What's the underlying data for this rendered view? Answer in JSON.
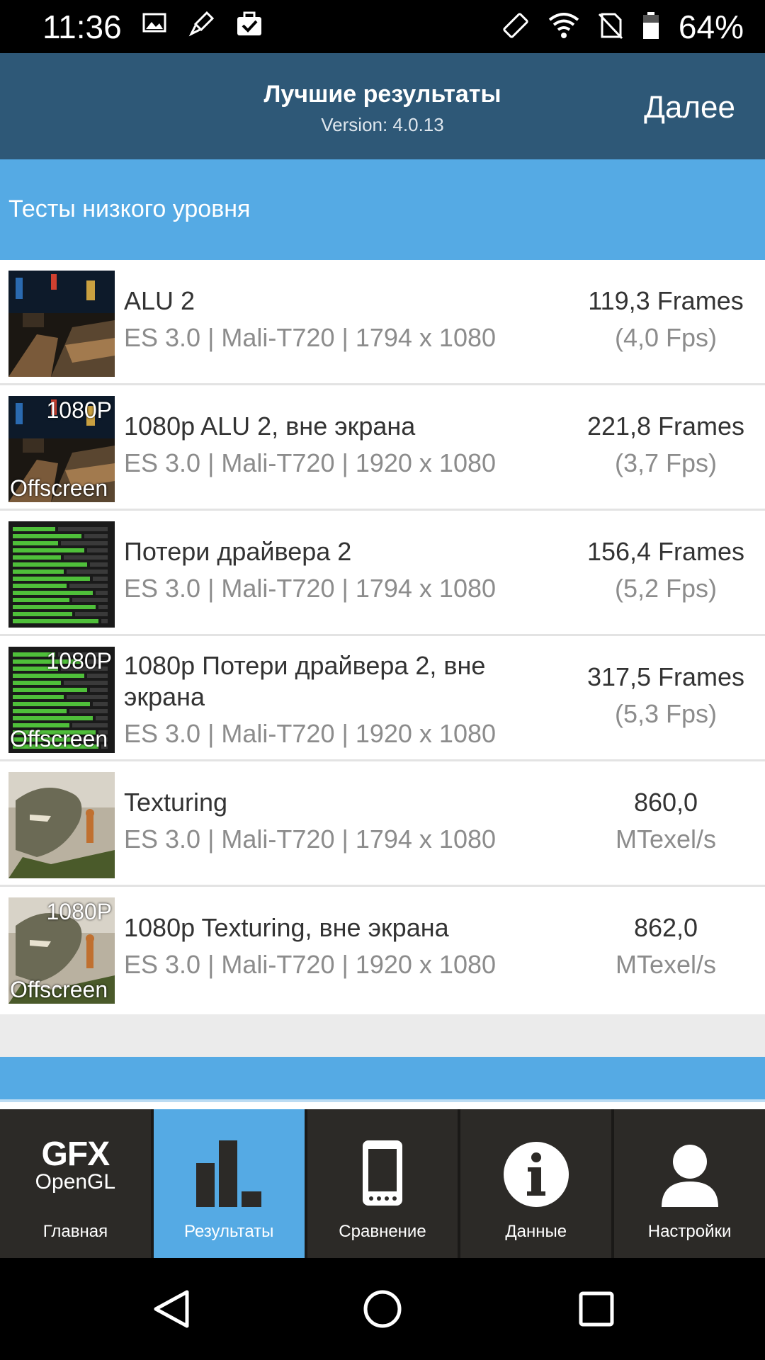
{
  "status_bar": {
    "time": "11:36",
    "battery_percent": "64%",
    "left_icons": [
      "image-icon",
      "brush-icon",
      "briefcase-check-icon"
    ],
    "right_icons": [
      "rotate-icon",
      "wifi-icon",
      "no-sim-icon",
      "battery-icon"
    ]
  },
  "header": {
    "title": "Лучшие результаты",
    "version": "Version: 4.0.13",
    "next_label": "Далее"
  },
  "section": {
    "title": "Тесты низкого уровня"
  },
  "results": [
    {
      "name": "ALU 2",
      "meta": "ES 3.0 | Mali-T720 | 1794 x 1080",
      "value": "119,3 Frames",
      "sub": "(4,0 Fps)",
      "thumb": "alu",
      "badge_top": "",
      "badge_bottom": ""
    },
    {
      "name": "1080p ALU 2, вне экрана",
      "meta": "ES 3.0 | Mali-T720 | 1920 x 1080",
      "value": "221,8 Frames",
      "sub": "(3,7 Fps)",
      "thumb": "alu",
      "badge_top": "1080P",
      "badge_bottom": "Offscreen"
    },
    {
      "name": "Потери драйвера 2",
      "meta": "ES 3.0 | Mali-T720 | 1794 x 1080",
      "value": "156,4 Frames",
      "sub": "(5,2 Fps)",
      "thumb": "driver",
      "badge_top": "",
      "badge_bottom": ""
    },
    {
      "name": "1080p Потери драйвера 2, вне экрана",
      "meta": "ES 3.0 | Mali-T720 | 1920 x 1080",
      "value": "317,5 Frames",
      "sub": "(5,3 Fps)",
      "thumb": "driver",
      "badge_top": "1080P",
      "badge_bottom": "Offscreen"
    },
    {
      "name": "Texturing",
      "meta": "ES 3.0 | Mali-T720 | 1794 x 1080",
      "value": "860,0",
      "sub": "MTexel/s",
      "thumb": "dino",
      "badge_top": "",
      "badge_bottom": ""
    },
    {
      "name": "1080p Texturing, вне экрана",
      "meta": "ES 3.0 | Mali-T720 | 1920 x 1080",
      "value": "862,0",
      "sub": "MTexel/s",
      "thumb": "dino",
      "badge_top": "1080P",
      "badge_bottom": "Offscreen"
    }
  ],
  "tabs": [
    {
      "label": "Главная",
      "icon": "gfx-opengl-logo",
      "logo_top": "GFX",
      "logo_bottom": "OpenGL",
      "active": false
    },
    {
      "label": "Результаты",
      "icon": "bar-chart-icon",
      "active": true
    },
    {
      "label": "Сравнение",
      "icon": "phone-icon",
      "active": false
    },
    {
      "label": "Данные",
      "icon": "info-icon",
      "active": false
    },
    {
      "label": "Настройки",
      "icon": "user-icon",
      "active": false
    }
  ],
  "nav": [
    "back-icon",
    "home-icon",
    "recents-icon"
  ],
  "colors": {
    "header_bg": "#2e5877",
    "section_bg": "#55aae4",
    "tabbar_bg": "#2c2a27",
    "active_tab_bg": "#55aae4"
  }
}
